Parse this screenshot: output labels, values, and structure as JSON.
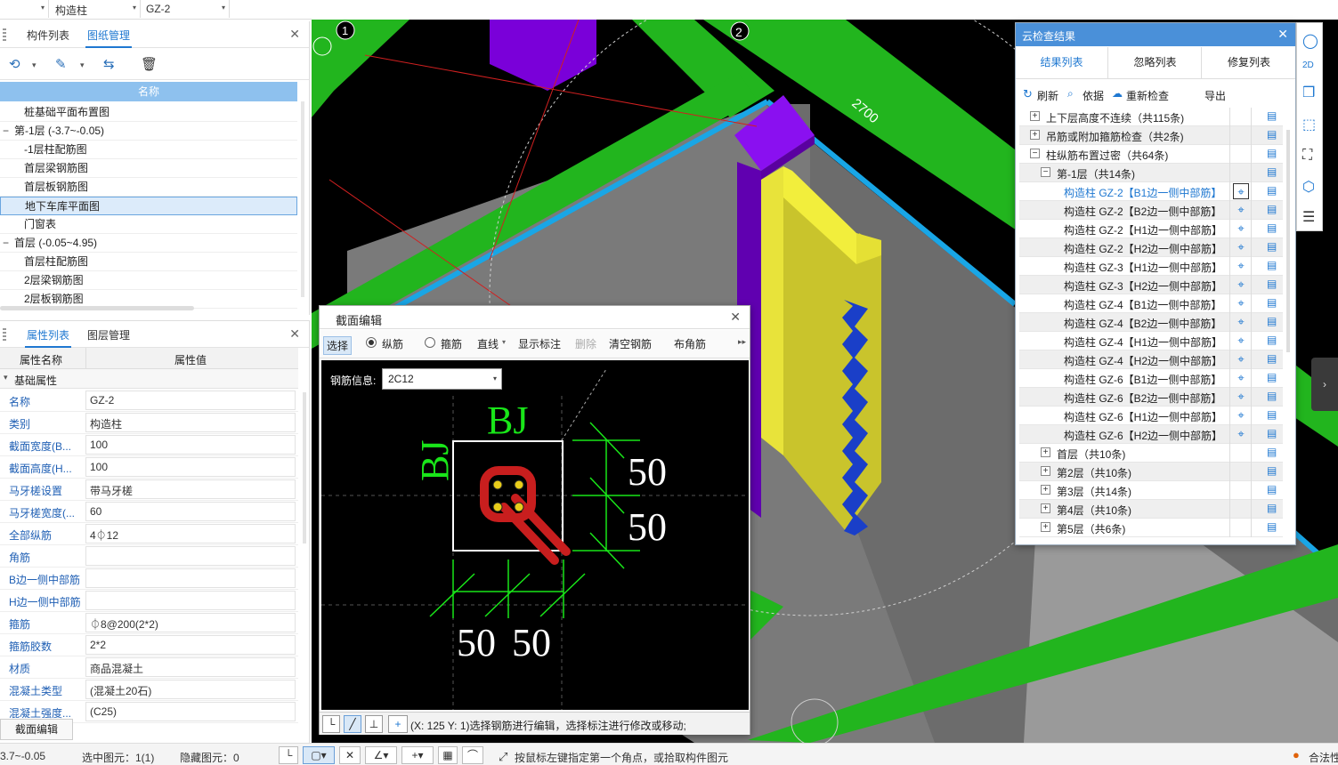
{
  "topbar": {
    "combo1": "构造柱",
    "combo2": "GZ-2"
  },
  "drawing_panel": {
    "tabs": [
      "构件列表",
      "图纸管理"
    ],
    "active_tab": "图纸管理",
    "header": "名称",
    "rows": [
      {
        "label": "桩基础平面布置图",
        "indent": 2,
        "expander": ""
      },
      {
        "label": "第-1层 (-3.7~-0.05)",
        "indent": 1,
        "expander": "−"
      },
      {
        "label": "-1层柱配筋图",
        "indent": 2,
        "expander": ""
      },
      {
        "label": "首层梁钢筋图",
        "indent": 2,
        "expander": ""
      },
      {
        "label": "首层板钢筋图",
        "indent": 2,
        "expander": ""
      },
      {
        "label": "地下车库平面图",
        "indent": 2,
        "expander": "",
        "selected": true
      },
      {
        "label": "门窗表",
        "indent": 2,
        "expander": ""
      },
      {
        "label": "首层 (-0.05~4.95)",
        "indent": 1,
        "expander": "−"
      },
      {
        "label": "首层柱配筋图",
        "indent": 2,
        "expander": ""
      },
      {
        "label": "2层梁钢筋图",
        "indent": 2,
        "expander": ""
      },
      {
        "label": "2层板钢筋图",
        "indent": 2,
        "expander": ""
      }
    ]
  },
  "property_panel": {
    "tabs": [
      "属性列表",
      "图层管理"
    ],
    "active_tab": "属性列表",
    "col_name": "属性名称",
    "col_value": "属性值",
    "group": "基础属性",
    "rows": [
      {
        "name": "名称",
        "value": "GZ-2"
      },
      {
        "name": "类别",
        "value": "构造柱"
      },
      {
        "name": "截面宽度(B...",
        "value": "100"
      },
      {
        "name": "截面高度(H...",
        "value": "100"
      },
      {
        "name": "马牙槎设置",
        "value": "带马牙槎"
      },
      {
        "name": "马牙槎宽度(...",
        "value": "60"
      },
      {
        "name": "全部纵筋",
        "value": "4⏀12"
      },
      {
        "name": "角筋",
        "value": ""
      },
      {
        "name": "B边一侧中部筋",
        "value": ""
      },
      {
        "name": "H边一侧中部筋",
        "value": ""
      },
      {
        "name": "箍筋",
        "value": "⏀8@200(2*2)"
      },
      {
        "name": "箍筋胶数",
        "value": "2*2"
      },
      {
        "name": "材质",
        "value": "商品混凝土"
      },
      {
        "name": "混凝土类型",
        "value": "(混凝土20石)"
      },
      {
        "name": "混凝土强度...",
        "value": "(C25)"
      }
    ],
    "bottom_button": "截面编辑"
  },
  "viewport": {
    "axis1": "1",
    "axis2": "2",
    "dim": "2700"
  },
  "section_dialog": {
    "title": "截面编辑",
    "toolbar": {
      "select": "选择",
      "radio_long": "纵筋",
      "radio_stirrup": "箍筋",
      "line": "直线",
      "show_dims": "显示标注",
      "delete": "删除",
      "clear": "清空钢筋",
      "corner": "布角筋"
    },
    "rebar_label": "钢筋信息:",
    "rebar_value": "2C12",
    "labels": {
      "bj_top": "BJ",
      "bj_left": "BJ",
      "d1": "50",
      "d2": "50",
      "d3": "50",
      "d4": "50"
    },
    "status": "(X: 125 Y: 1)选择钢筋进行编辑，选择标注进行修改或移动;"
  },
  "cloud_panel": {
    "title": "云检查结果",
    "tabs": [
      "结果列表",
      "忽略列表",
      "修复列表"
    ],
    "actions": {
      "refresh": "刷新",
      "basis": "依据",
      "recheck": "重新检查",
      "export": "导出"
    },
    "rows": [
      {
        "label": "上下层高度不连续（共115条)",
        "level": 0,
        "exp": "+"
      },
      {
        "label": "吊筋或附加箍筋检查（共2条)",
        "level": 0,
        "exp": "+"
      },
      {
        "label": "柱纵筋布置过密（共64条)",
        "level": 0,
        "exp": "−"
      },
      {
        "label": "第-1层（共14条)",
        "level": 1,
        "exp": "−"
      },
      {
        "label": "构造柱 GZ-2【B1边一侧中部筋】",
        "level": 2,
        "active": true
      },
      {
        "label": "构造柱 GZ-2【B2边一侧中部筋】",
        "level": 2
      },
      {
        "label": "构造柱 GZ-2【H1边一侧中部筋】",
        "level": 2
      },
      {
        "label": "构造柱 GZ-2【H2边一侧中部筋】",
        "level": 2
      },
      {
        "label": "构造柱 GZ-3【H1边一侧中部筋】",
        "level": 2
      },
      {
        "label": "构造柱 GZ-3【H2边一侧中部筋】",
        "level": 2
      },
      {
        "label": "构造柱 GZ-4【B1边一侧中部筋】",
        "level": 2
      },
      {
        "label": "构造柱 GZ-4【B2边一侧中部筋】",
        "level": 2
      },
      {
        "label": "构造柱 GZ-4【H1边一侧中部筋】",
        "level": 2
      },
      {
        "label": "构造柱 GZ-4【H2边一侧中部筋】",
        "level": 2
      },
      {
        "label": "构造柱 GZ-6【B1边一侧中部筋】",
        "level": 2
      },
      {
        "label": "构造柱 GZ-6【B2边一侧中部筋】",
        "level": 2
      },
      {
        "label": "构造柱 GZ-6【H1边一侧中部筋】",
        "level": 2
      },
      {
        "label": "构造柱 GZ-6【H2边一侧中部筋】",
        "level": 2
      },
      {
        "label": "首层（共10条)",
        "level": 1,
        "exp": "+"
      },
      {
        "label": "第2层（共10条)",
        "level": 1,
        "exp": "+"
      },
      {
        "label": "第3层（共14条)",
        "level": 1,
        "exp": "+"
      },
      {
        "label": "第4层（共10条)",
        "level": 1,
        "exp": "+"
      },
      {
        "label": "第5层（共6条)",
        "level": 1,
        "exp": "+"
      }
    ]
  },
  "statusbar": {
    "elev": "3.7~-0.05",
    "selected": "选中图元：1(1)",
    "hidden": "隐藏图元：0",
    "hint": "按鼠标左键指定第一个角点，或拾取构件图元",
    "legal": "合法性"
  },
  "colors": {
    "accent": "#1f78d1",
    "beam": "#22b51e",
    "wall": "#8a8a8a",
    "column": "#7a00d9",
    "gz": "#d6d22a",
    "rebar": "#c81e1e",
    "dim": "#19e619"
  }
}
